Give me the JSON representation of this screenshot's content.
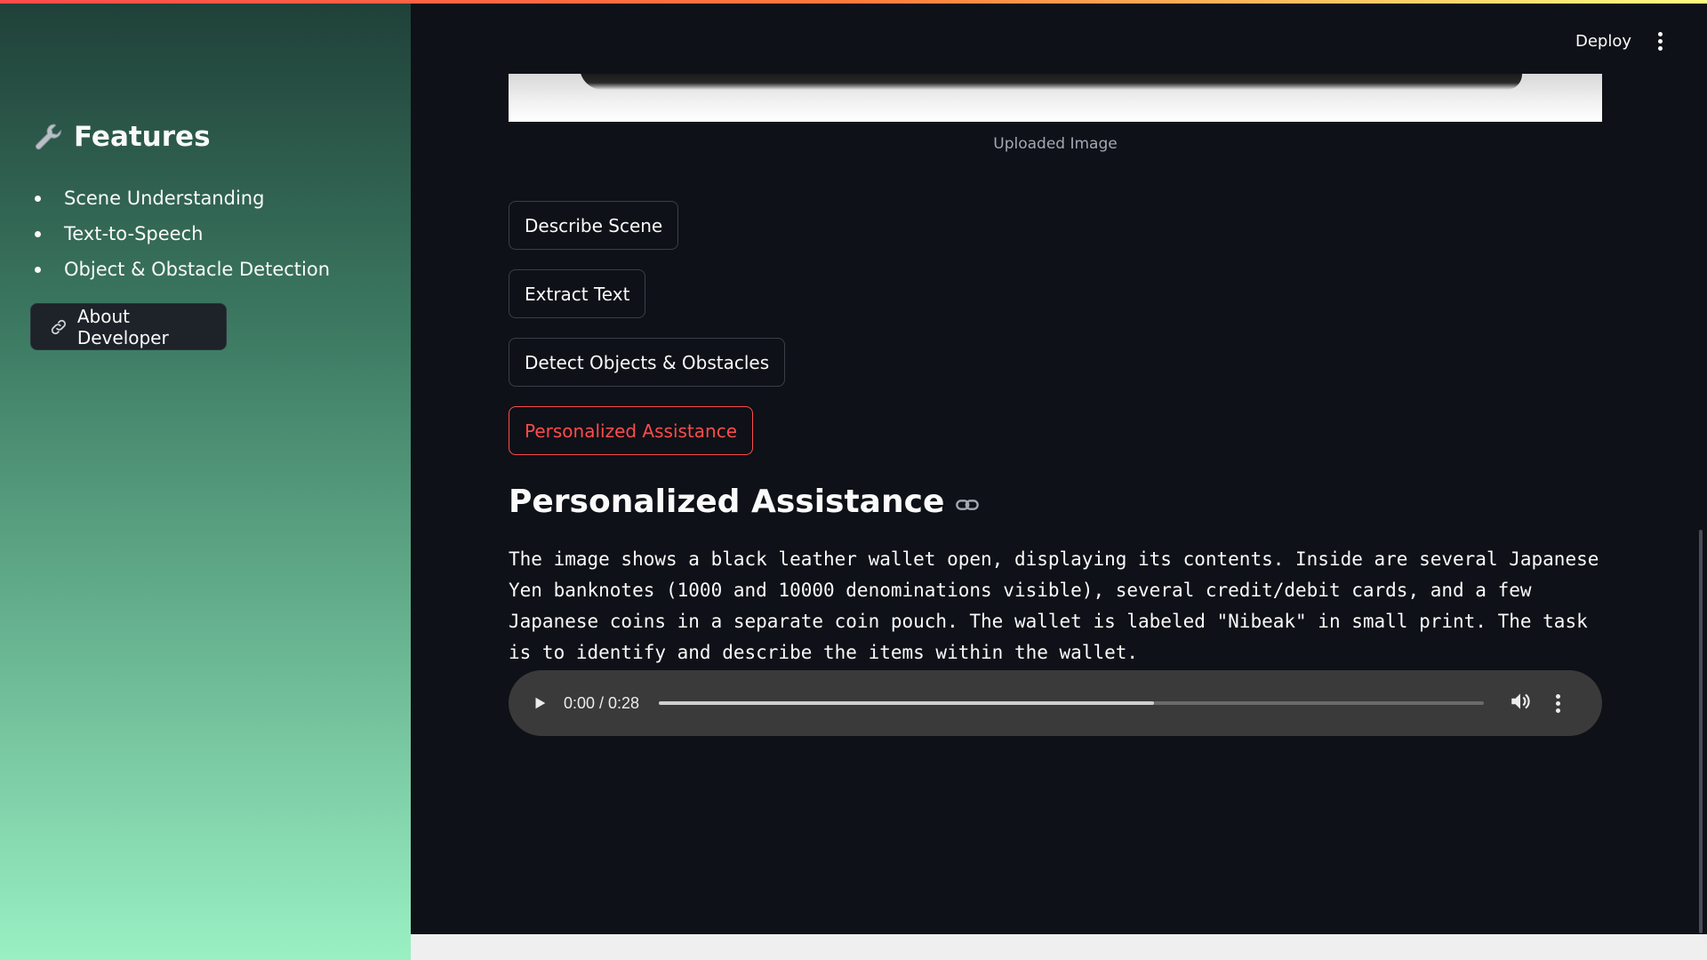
{
  "header": {
    "deploy_label": "Deploy",
    "menu_icon": "vertical-ellipsis-icon"
  },
  "sidebar": {
    "heading_icon": "wrench-icon",
    "heading": "Features",
    "items": [
      {
        "label": "Scene Understanding"
      },
      {
        "label": "Text-to-Speech"
      },
      {
        "label": "Object & Obstacle Detection"
      }
    ],
    "about_button": {
      "icon": "link-icon",
      "label": "About Developer"
    }
  },
  "main": {
    "image_caption": "Uploaded Image",
    "buttons": [
      {
        "label": "Describe Scene"
      },
      {
        "label": "Extract Text"
      },
      {
        "label": "Detect Objects & Obstacles"
      },
      {
        "label": "Personalized Assistance"
      }
    ],
    "section_title": "Personalized Assistance",
    "section_anchor_icon": "link-icon",
    "output_text": "The image shows a black leather wallet open, displaying its contents. Inside are several Japanese Yen banknotes (1000 and 10000 denominations visible), several credit/debit cards, and a few Japanese coins in a separate coin pouch. The wallet is labeled \"Nibeak\" in small print. The task is to identify and describe the items within the wallet.",
    "audio": {
      "time": "0:00 / 0:28",
      "progress_fraction": 0.6,
      "play_icon": "play-icon",
      "volume_icon": "volume-icon",
      "more_icon": "vertical-ellipsis-icon"
    }
  },
  "colors": {
    "background": "#0e1117",
    "accent": "#ff4b4b",
    "sidebar_top": "#1f4038",
    "sidebar_bottom": "#9af0c3"
  }
}
